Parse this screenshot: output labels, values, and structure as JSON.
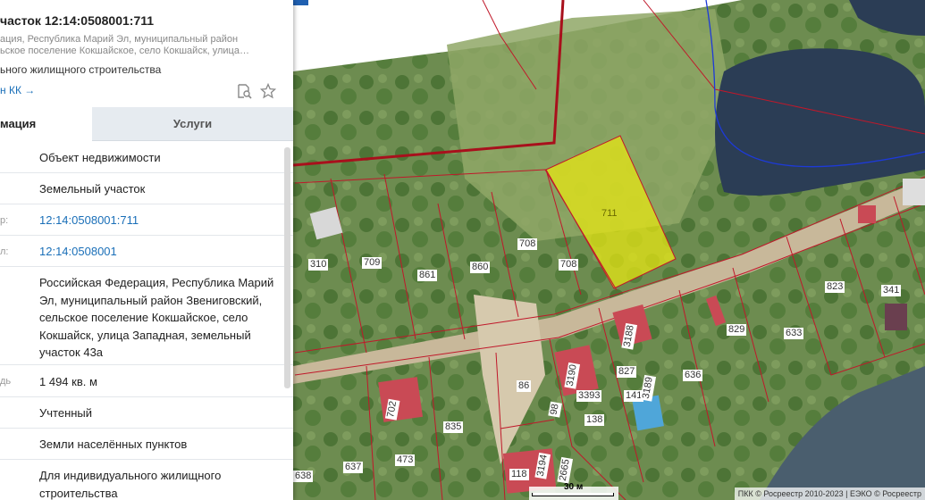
{
  "panel": {
    "title": "часток 12:14:0508001:711",
    "address_line1": "ация, Республика Марий Эл, муниципальный район",
    "address_line2": "ьское поселение Кокшайское, село Кокшайск, улица…",
    "purpose": "ьного жилищного строительства",
    "link": "н КК →",
    "tabs": {
      "info": "мация",
      "services": "Услуги"
    },
    "rows": [
      {
        "key": "",
        "value": "Объект недвижимости",
        "link": false
      },
      {
        "key": "",
        "value": "Земельный участок",
        "link": false
      },
      {
        "key": "р:",
        "value": "12:14:0508001:711",
        "link": true
      },
      {
        "key": "л:",
        "value": "12:14:0508001",
        "link": true
      },
      {
        "key": "",
        "value": "Российская Федерация, Республика Марий Эл, муниципальный район Звениговский, сельское поселение Кокшайское, село Кокшайск, улица Западная, земельный участок 43а",
        "link": false
      },
      {
        "key": "дь:",
        "value": "1 494 кв. м",
        "link": false
      },
      {
        "key": "",
        "value": "Учтенный",
        "link": false
      },
      {
        "key": "",
        "value": "Земли населённых пунктов",
        "link": false
      },
      {
        "key": "",
        "value": "Для индивидуального жилищного строительства",
        "link": false
      }
    ],
    "icons": {
      "doc": "search-document-icon",
      "star": "star-icon"
    }
  },
  "map": {
    "selected_label": "711",
    "labels": [
      "310",
      "709",
      "861",
      "860",
      "708",
      "708",
      "829",
      "633",
      "823",
      "341",
      "3188",
      "827",
      "3190",
      "3393",
      "141",
      "3189",
      "636",
      "138",
      "702",
      "835",
      "86",
      "98",
      "473",
      "637",
      "638",
      "118",
      "3194",
      "2665"
    ],
    "scale_label": "30 м",
    "attribution": "ПКК © Росреестр 2010-2023 | ЕЭКО © Росреестр"
  },
  "colors": {
    "selected_fill": "#e6e614",
    "boundary": "#c0182a",
    "accent": "#1a6fb8",
    "water": "#2b3d55"
  }
}
